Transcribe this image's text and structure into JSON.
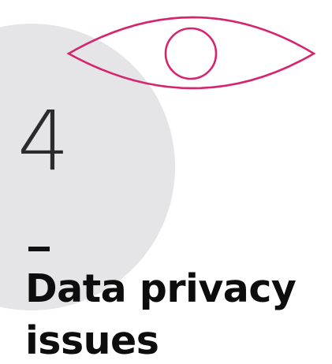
{
  "slide": {
    "number": "4",
    "title_lines": [
      "Data privacy",
      "issues"
    ]
  },
  "colors": {
    "accent": "#d6246e",
    "circle": "#e5e5e7",
    "text": "#0d0d0d"
  },
  "icons": {
    "eye": "eye-outline-icon"
  }
}
